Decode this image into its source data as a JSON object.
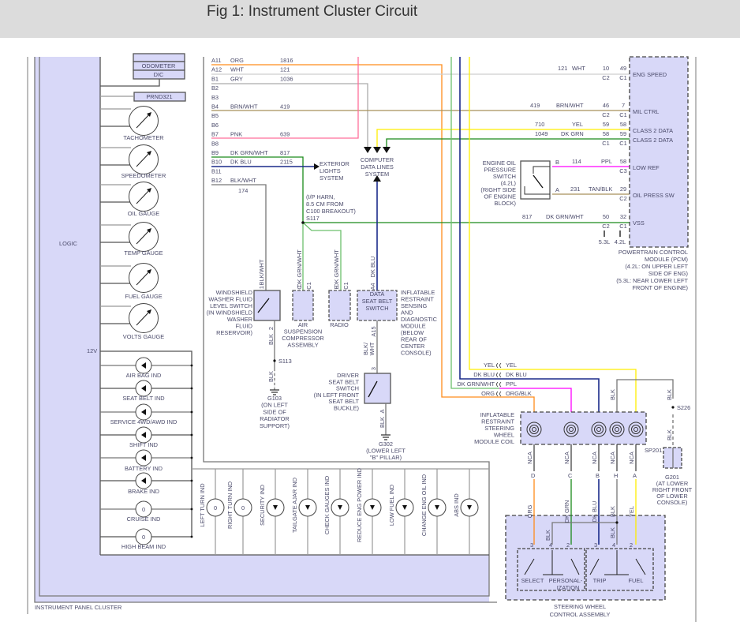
{
  "header": {
    "title": "Fig 1: Instrument Cluster Circuit"
  },
  "colors": {
    "lavender": "#d8d8f8",
    "org": "#ff8c1a",
    "wht": "#cfcfcf",
    "gry": "#aaaaaa",
    "brn": "#a8905a",
    "pnk": "#ff6f9a",
    "yel": "#ffee00",
    "dkgrn": "#1a8a1a",
    "ltgrn": "#6cc06c",
    "dkblu": "#1a2a8a",
    "ppl": "#ff00ff",
    "blk": "#666666"
  },
  "cluster": {
    "name": "INSTRUMENT PANEL CLUSTER",
    "logic": "LOGIC",
    "odometer": "ODOMETER",
    "dic": "DIC",
    "prnd": "PRND321",
    "v12": "12V",
    "gauges": [
      "TACHOMETER",
      "SPEEDOMETER",
      "OIL GAUGE",
      "TEMP GAUGE",
      "FUEL GAUGE",
      "VOLTS GAUGE"
    ],
    "indicators": [
      "AIR BAG IND",
      "SEAT BELT IND",
      "SERVICE 4WD/AWD IND",
      "SHIFT IND",
      "BATTERY IND",
      "BRAKE IND",
      "CRUISE IND",
      "HIGH BEAM IND"
    ],
    "bottom_indicators": [
      "LEFT TURN IND",
      "RIGHT TURN IND",
      "SECURITY IND",
      "TAILGATE AJAR IND",
      "CHECK GAUGES IND",
      "REDUCE ENG POWER IND",
      "LOW FUEL IND",
      "CHANGE ENG OIL IND",
      "ABS IND"
    ]
  },
  "connector": [
    {
      "pin": "A11",
      "color": "ORG",
      "circuit": "1816"
    },
    {
      "pin": "A12",
      "color": "WHT",
      "circuit": "121"
    },
    {
      "pin": "B1",
      "color": "GRY",
      "circuit": "1036"
    },
    {
      "pin": "B2",
      "color": "",
      "circuit": ""
    },
    {
      "pin": "B3",
      "color": "",
      "circuit": ""
    },
    {
      "pin": "B4",
      "color": "BRN/WHT",
      "circuit": "419"
    },
    {
      "pin": "B5",
      "color": "",
      "circuit": ""
    },
    {
      "pin": "B6",
      "color": "",
      "circuit": ""
    },
    {
      "pin": "B7",
      "color": "PNK",
      "circuit": "639"
    },
    {
      "pin": "B8",
      "color": "",
      "circuit": ""
    },
    {
      "pin": "B9",
      "color": "DK GRN/WHT",
      "circuit": "817"
    },
    {
      "pin": "B10",
      "color": "DK BLU",
      "circuit": "2115"
    },
    {
      "pin": "B11",
      "color": "",
      "circuit": ""
    },
    {
      "pin": "B12",
      "color": "BLK/WHT",
      "circuit": "174"
    }
  ],
  "exterior": [
    "EXTERIOR",
    "LIGHTS",
    "SYSTEM"
  ],
  "data_lines": [
    "COMPUTER",
    "DATA LINES",
    "SYSTEM"
  ],
  "s117": [
    "(I/P HARN,",
    "8.5 CM FROM",
    "C100 BREAKOUT)",
    "S117"
  ],
  "pcm": {
    "rows": [
      {
        "circuit": "121",
        "color": "WHT",
        "c2pin": "10",
        "c2": "C2",
        "c1pin": "49",
        "c1": "C1",
        "label": "ENG SPEED"
      },
      {
        "circuit": "419",
        "color": "BRN/WHT",
        "c2pin": "46",
        "c2": "C2",
        "c1pin": "7",
        "c1": "C1",
        "label": "MIL CTRL"
      },
      {
        "circuit": "710",
        "color": "YEL",
        "c2pin": "59",
        "c1pin": "58",
        "label": "CLASS 2 DATA"
      },
      {
        "circuit": "1049",
        "color": "DK GRN",
        "c2pin": "58",
        "c2": "C1",
        "c1pin": "59",
        "c1": "C1",
        "label": "CLASS 2 DATA"
      },
      {
        "circuit": "114",
        "color": "PPL",
        "c1pin": "58",
        "c1": "C3",
        "label": "LOW REF",
        "sw_pin": "B"
      },
      {
        "circuit": "231",
        "color": "TAN/BLK",
        "c1pin": "29",
        "c1": "C2",
        "label": "OIL PRESS SW",
        "sw_pin": "A"
      },
      {
        "circuit": "817",
        "color": "DK GRN/WHT",
        "c2pin": "50",
        "c2": "C2",
        "c1pin": "32",
        "c1": "C1",
        "label": "VSS"
      }
    ],
    "engine_53": "5.3L",
    "engine_42": "4.2L",
    "caption": [
      "POWERTRAIN CONTROL",
      "MODULE (PCM)",
      "(4.2L: ON UPPER LEFT",
      "SIDE OF ENG)",
      "(5.3L: NEAR LOWER LEFT",
      "FRONT OF ENGINE)"
    ]
  },
  "oil_switch": [
    "ENGINE OIL",
    "PRESSURE",
    "SWITCH",
    "(4.2L)",
    "(RIGHT SIDE",
    "OF ENGINE",
    "BLOCK)"
  ],
  "windshield": {
    "pin_top": "1",
    "pin_bottom": "2",
    "wire_top": "BLK/WHT",
    "wire_bottom": "BLK",
    "lines": [
      "WINDSHIELD",
      "WASHER FLUID",
      "LEVEL SWITCH",
      "(IN WINDSHIELD",
      "WASHER",
      "FLUID",
      "RESERVOIR)"
    ]
  },
  "s113": "S113",
  "blk": "BLK",
  "g103": [
    "G103",
    "(ON LEFT",
    "SIDE OF",
    "RADIATOR",
    "SUPPORT)"
  ],
  "air_susp": {
    "pin": "C",
    "conn": "C1",
    "wire": "DK GRN/WHT",
    "lines": [
      "AIR",
      "SUSPENSION",
      "COMPRESSOR",
      "ASSEMBLY"
    ]
  },
  "radio": {
    "pin": "E",
    "conn": "C1",
    "wire": "DK GRN/WHT",
    "label": "RADIO"
  },
  "sdm": {
    "pin_top": "A4",
    "wire_top": "DK BLU",
    "inner": [
      "DATA",
      "SEAT BELT",
      "SWITCH"
    ],
    "pin_bottom": "A15",
    "wire_bottom": [
      "BLK/",
      "WHT"
    ],
    "lines": [
      "INFLATABLE",
      "RESTRAINT",
      "SENSING",
      "AND",
      "DIAGNOSTIC",
      "MODULE",
      "(BELOW",
      "REAR OF",
      "CENTER",
      "CONSOLE)"
    ]
  },
  "driver_switch": {
    "pin_top": "3",
    "pin_bottom": "A",
    "lines": [
      "DRIVER",
      "SEAT BELT",
      "SWITCH",
      "(IN LEFT FRONT",
      "SEAT BELT",
      "BUCKLE)"
    ]
  },
  "g302": [
    "G302",
    "(LOWER LEFT",
    "\"B\" PILLAR)"
  ],
  "inline": [
    [
      "YEL",
      "YEL"
    ],
    [
      "DK BLU",
      "DK BLU"
    ],
    [
      "DK GRN/WHT",
      "PPL"
    ],
    [
      "ORG",
      "ORG/BLK"
    ]
  ],
  "coil": {
    "lines": [
      "INFLATABLE",
      "RESTRAINT",
      "STEERING",
      "WHEEL",
      "MODULE COIL"
    ],
    "nca": "NCA",
    "pins": [
      "D",
      "C",
      "B",
      "H",
      "A"
    ]
  },
  "s226": "S226",
  "sp201": "SP201",
  "g201": [
    "G201",
    "(AT LOWER",
    "RIGHT FRONT",
    "OF LOWER",
    "CONSOLE)"
  ],
  "steering": {
    "wires": [
      "ORG",
      "DK GRN",
      "DK BLU",
      "BLK",
      "YEL"
    ],
    "pins": [
      "3",
      "4",
      "2",
      "3",
      "4",
      "2"
    ],
    "switches": [
      "SELECT",
      "PERSONAL-",
      "IZATION",
      "TRIP",
      "FUEL"
    ],
    "caption": [
      "STEERING WHEEL",
      "CONTROL ASSEMBLY"
    ]
  }
}
